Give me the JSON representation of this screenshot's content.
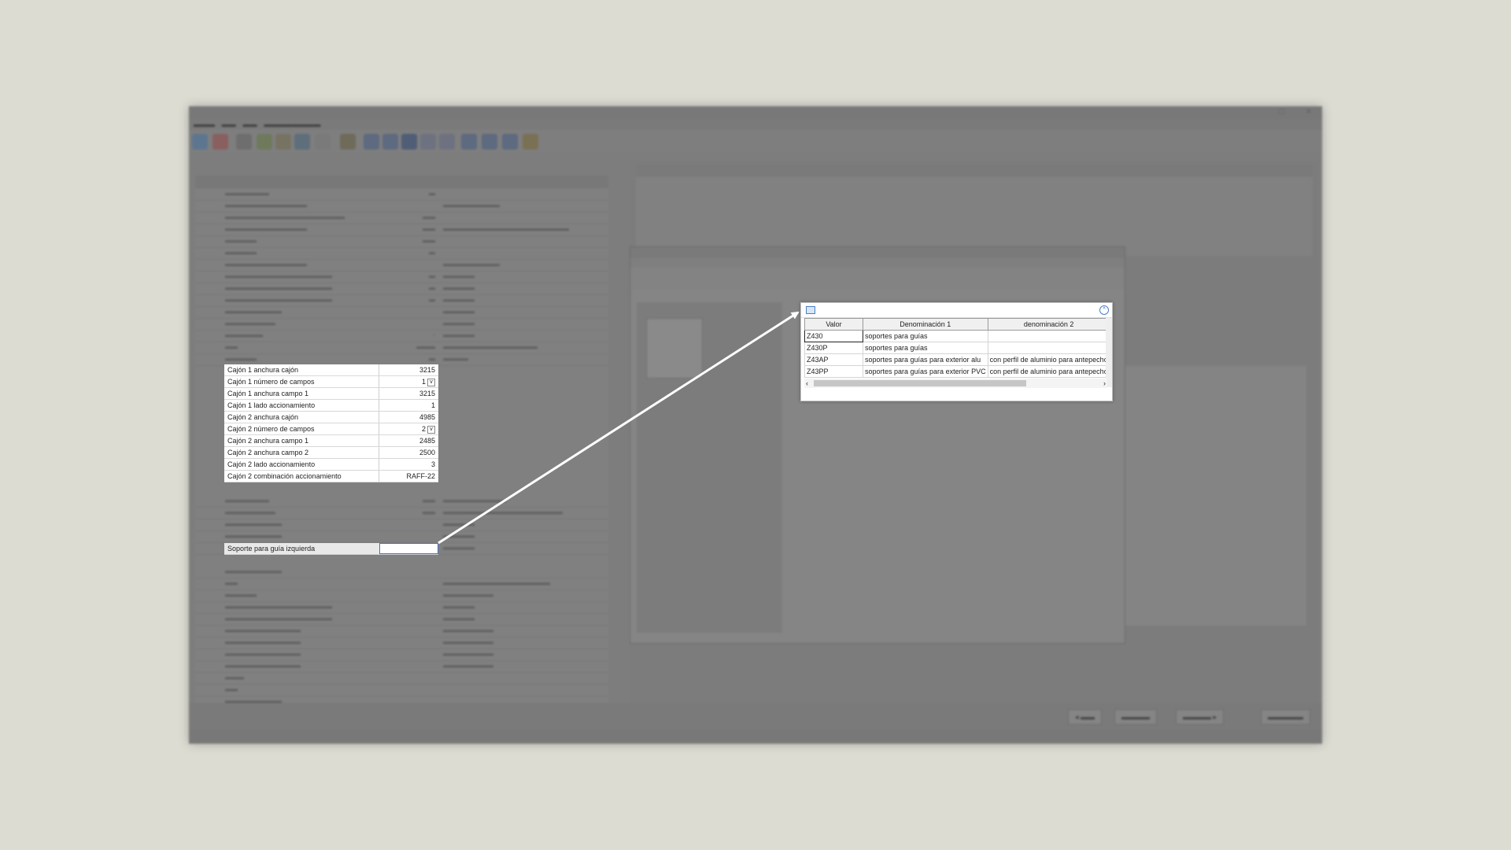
{
  "overlay_rows": [
    {
      "label": "Cajón 1 anchura cajón",
      "value": "3215",
      "dropdown": false
    },
    {
      "label": "Cajón 1 número de campos",
      "value": "1",
      "dropdown": true
    },
    {
      "label": "Cajón 1 anchura campo 1",
      "value": "3215",
      "dropdown": false
    },
    {
      "label": "Cajón 1 lado accionamiento",
      "value": "1",
      "dropdown": false
    },
    {
      "label": "Cajón 2 anchura cajón",
      "value": "4985",
      "dropdown": false
    },
    {
      "label": "Cajón 2 número de campos",
      "value": "2",
      "dropdown": true
    },
    {
      "label": "Cajón 2 anchura campo 1",
      "value": "2485",
      "dropdown": false
    },
    {
      "label": "Cajón 2 anchura campo 2",
      "value": "2500",
      "dropdown": false
    },
    {
      "label": "Cajón 2 lado accionamiento",
      "value": "3",
      "dropdown": false
    },
    {
      "label": "Cajón 2 combinación accionamiento",
      "value": "RAFF-22",
      "dropdown": false
    }
  ],
  "selected_row": {
    "label": "Soporte para guía izquierda",
    "value": ""
  },
  "lookup": {
    "columns": [
      "Valor",
      "Denominación 1",
      "denominación 2"
    ],
    "rows": [
      [
        "Z430",
        "soportes para guías",
        ""
      ],
      [
        "Z430P",
        "soportes para guías",
        ""
      ],
      [
        "Z43AP",
        "soportes para guías para exterior alu",
        "con perfil de aluminio para antepecho"
      ],
      [
        "Z43PP",
        "soportes para guías para exterior PVC",
        "con perfil de aluminio para antepecho"
      ]
    ]
  },
  "colors": {
    "arrow": "#ffffff",
    "selection_border": "#4a6fd0"
  }
}
